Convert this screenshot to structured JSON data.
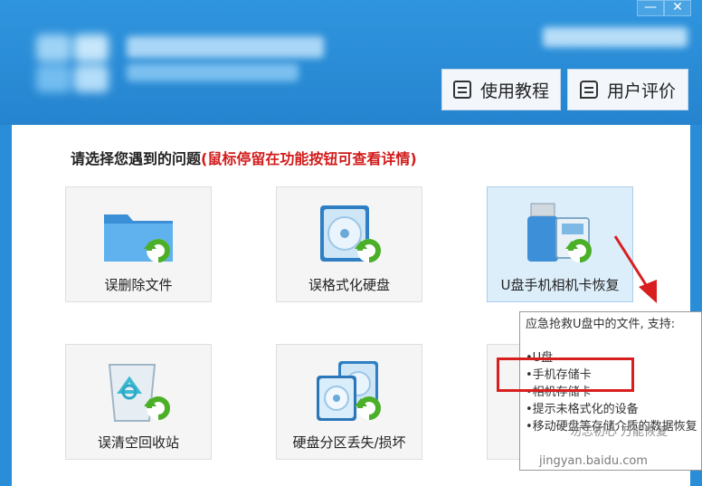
{
  "window": {
    "minimize_glyph": "—",
    "close_glyph": "✕"
  },
  "toolbar": {
    "tutorial_label": "使用教程",
    "review_label": "用户评价"
  },
  "main": {
    "prompt_text": "请选择您遇到的问题",
    "prompt_hint": "(鼠标停留在功能按钮可查看详情)",
    "tiles": [
      {
        "label": "误删除文件",
        "icon": "folder-restore-icon"
      },
      {
        "label": "误格式化硬盘",
        "icon": "disk-restore-icon"
      },
      {
        "label": "U盘手机相机卡恢复",
        "icon": "usb-card-restore-icon"
      },
      {
        "label": "误清空回收站",
        "icon": "recycle-bin-restore-icon"
      },
      {
        "label": "硬盘分区丢失/损坏",
        "icon": "partition-restore-icon"
      }
    ]
  },
  "tooltip": {
    "header": "应急抢救U盘中的文件, 支持:",
    "items": [
      "•U盘",
      "•手机存储卡",
      "•相机存储卡",
      "•提示未格式化的设备",
      "•移动硬盘等存储介质的数据恢复"
    ]
  },
  "watermark": {
    "text": "勿忘初心 万能恢复",
    "url": "jingyan.baidu.com"
  },
  "colors": {
    "titlebar": "#2a8dd8",
    "prompt_hint": "#d21b1b",
    "annotation_red": "#d81e1e",
    "tile_highlight": "#ddeefb"
  }
}
